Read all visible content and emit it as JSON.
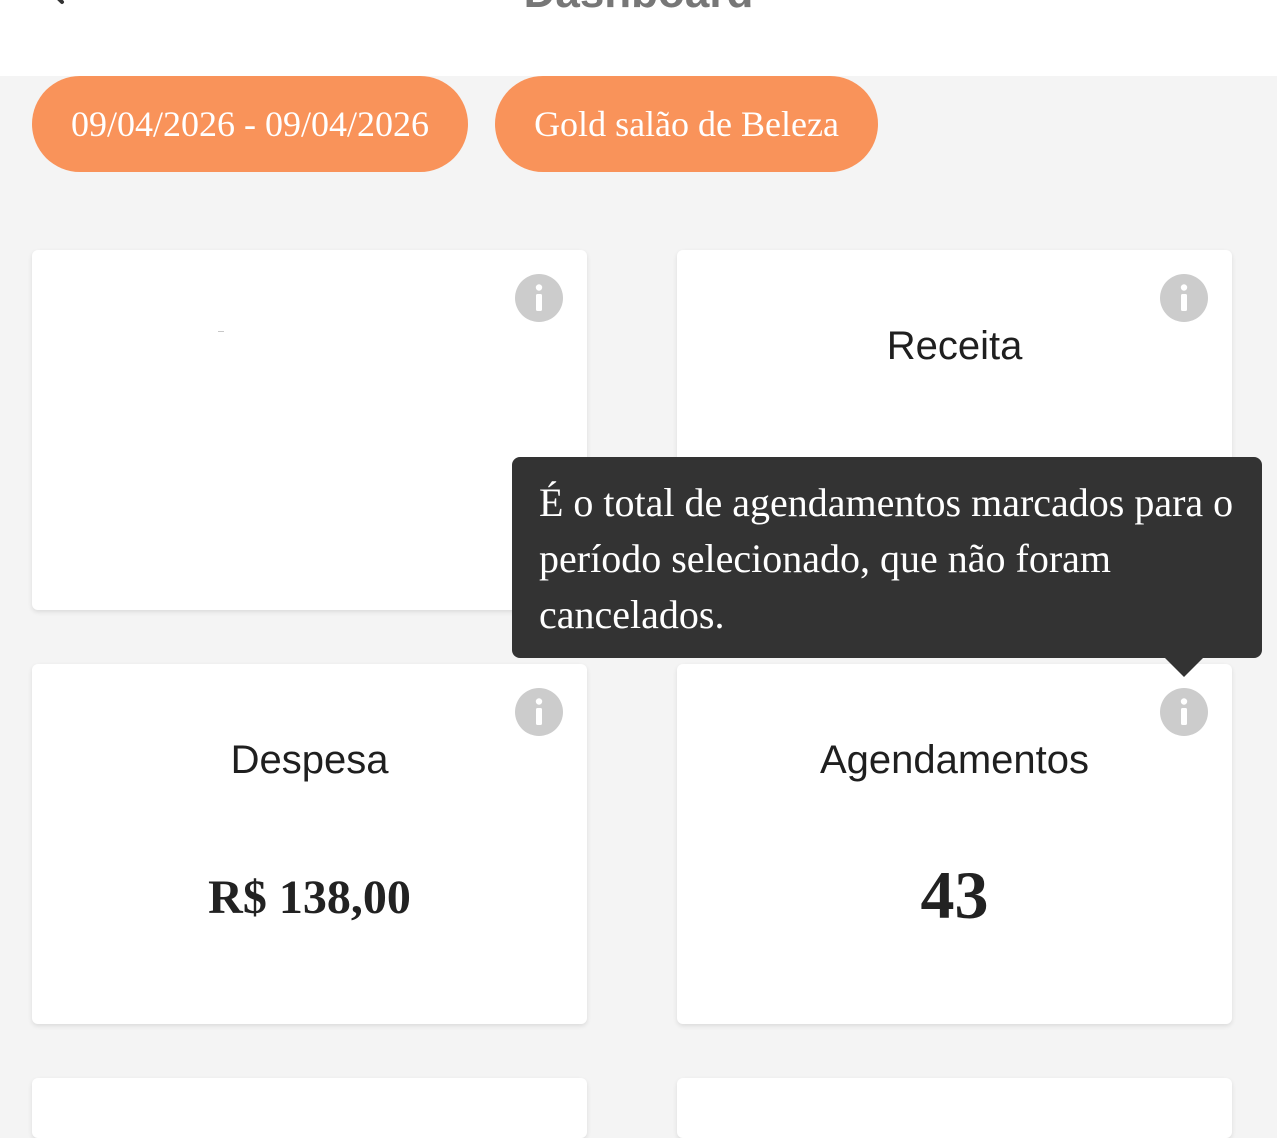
{
  "header": {
    "title": "Dashboard"
  },
  "filters": {
    "date_range": "09/04/2026 - 09/04/2026",
    "store": "Gold salão de Beleza"
  },
  "cards": [
    {
      "title": "",
      "value": ""
    },
    {
      "title": "Receita",
      "value": ""
    },
    {
      "title": "Despesa",
      "value": "R$ 138,00"
    },
    {
      "title": "Agendamentos",
      "value": "43"
    }
  ],
  "tooltip": {
    "text": "É o total de agendamentos marcados para o período selecionado, que não foram cancelados."
  },
  "colors": {
    "accent": "#f9935a",
    "background": "#f4f4f4",
    "card": "#ffffff",
    "tooltip": "#333333",
    "info_icon": "#cccccc"
  },
  "icons": {
    "back": "chevron-left-icon",
    "info": "info-icon"
  }
}
